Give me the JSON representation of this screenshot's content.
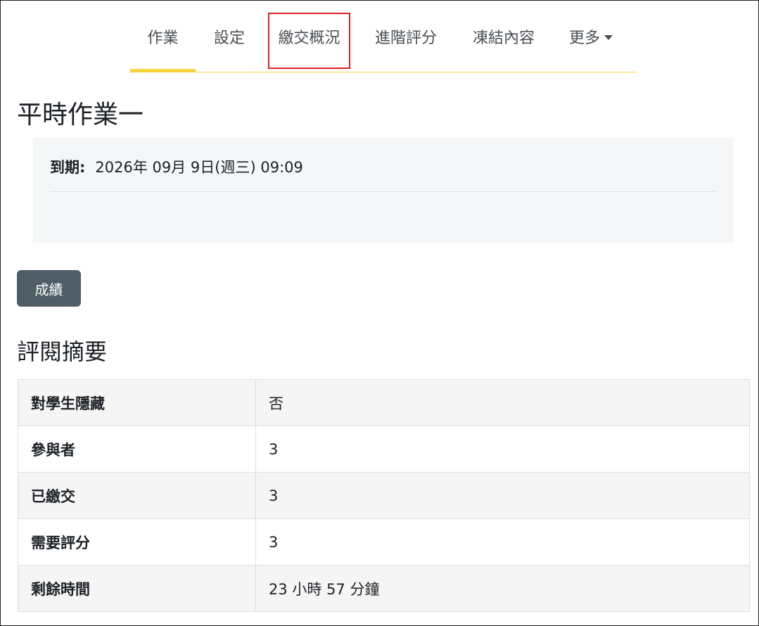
{
  "tabs": [
    {
      "label": "作業",
      "active": true
    },
    {
      "label": "設定"
    },
    {
      "label": "繳交概況",
      "highlighted": true
    },
    {
      "label": "進階評分"
    },
    {
      "label": "凍結內容"
    },
    {
      "label": "更多"
    }
  ],
  "page_title": "平時作業一",
  "due": {
    "label": "到期:",
    "value": "2026年 09月 9日(週三) 09:09"
  },
  "grades_button": "成績",
  "summary": {
    "heading": "評閱摘要",
    "rows": [
      {
        "label": "對學生隱藏",
        "value": "否"
      },
      {
        "label": "參與者",
        "value": "3"
      },
      {
        "label": "已繳交",
        "value": "3"
      },
      {
        "label": "需要評分",
        "value": "3"
      },
      {
        "label": "剩餘時間",
        "value": "23 小時 57 分鐘"
      }
    ]
  },
  "colors": {
    "accent": "#f5d33b",
    "highlight_border": "#e02020",
    "button_bg": "#4f5e66"
  }
}
